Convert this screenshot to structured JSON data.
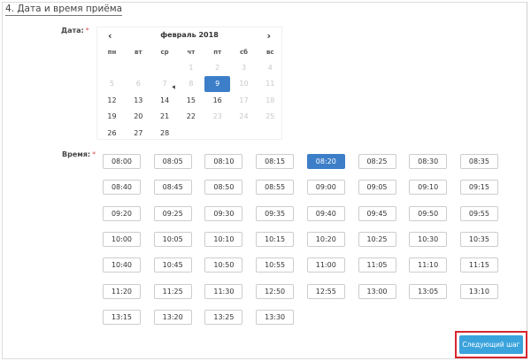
{
  "section": {
    "title": "4. Дата и время приёма"
  },
  "date_field": {
    "label": "Дата:",
    "required_mark": "*"
  },
  "time_field": {
    "label": "Время:",
    "required_mark": "*"
  },
  "calendar": {
    "month_label": "февраль 2018",
    "prev_icon": "‹",
    "next_icon": "›",
    "weekdays": [
      "пн",
      "вт",
      "ср",
      "чт",
      "пт",
      "сб",
      "вс"
    ],
    "weeks": [
      [
        {
          "d": ""
        },
        {
          "d": ""
        },
        {
          "d": ""
        },
        {
          "d": "1",
          "s": "disabled"
        },
        {
          "d": "2",
          "s": "disabled"
        },
        {
          "d": "3",
          "s": "disabled"
        },
        {
          "d": "4",
          "s": "disabled"
        }
      ],
      [
        {
          "d": "5",
          "s": "disabled"
        },
        {
          "d": "6",
          "s": "disabled"
        },
        {
          "d": "7",
          "s": "disabled"
        },
        {
          "d": "8",
          "s": "disabled"
        },
        {
          "d": "9",
          "s": "selected"
        },
        {
          "d": "10",
          "s": "disabled"
        },
        {
          "d": "11",
          "s": "disabled"
        }
      ],
      [
        {
          "d": "12"
        },
        {
          "d": "13"
        },
        {
          "d": "14"
        },
        {
          "d": "15"
        },
        {
          "d": "16"
        },
        {
          "d": "17",
          "s": "disabled"
        },
        {
          "d": "18",
          "s": "disabled"
        }
      ],
      [
        {
          "d": "19"
        },
        {
          "d": "20"
        },
        {
          "d": "21"
        },
        {
          "d": "22"
        },
        {
          "d": "23",
          "s": "disabled"
        },
        {
          "d": "24",
          "s": "disabled"
        },
        {
          "d": "25",
          "s": "disabled"
        }
      ],
      [
        {
          "d": "26"
        },
        {
          "d": "27"
        },
        {
          "d": "28"
        },
        {
          "d": ""
        },
        {
          "d": ""
        },
        {
          "d": ""
        },
        {
          "d": ""
        }
      ]
    ]
  },
  "time_slots": [
    "08:00",
    "08:05",
    "08:10",
    "08:15",
    "08:20",
    "08:25",
    "08:30",
    "08:35",
    "08:40",
    "08:45",
    "08:50",
    "08:55",
    "09:00",
    "09:05",
    "09:10",
    "09:15",
    "09:20",
    "09:25",
    "09:30",
    "09:35",
    "09:40",
    "09:45",
    "09:50",
    "09:55",
    "10:00",
    "10:05",
    "10:10",
    "10:15",
    "10:20",
    "10:25",
    "10:30",
    "10:35",
    "10:40",
    "10:45",
    "10:50",
    "10:55",
    "11:00",
    "11:05",
    "11:10",
    "11:15",
    "11:20",
    "11:25",
    "11:30",
    "12:50",
    "12:55",
    "13:00",
    "13:05",
    "13:10",
    "13:15",
    "13:20",
    "13:25",
    "13:30"
  ],
  "selected_time": "08:20",
  "colors": {
    "accent": "#3d7ec8",
    "button": "#3aa3dc",
    "highlight_frame": "#d6262f",
    "required": "#d9534f"
  },
  "next_button": {
    "label": "Следующий шаг"
  }
}
